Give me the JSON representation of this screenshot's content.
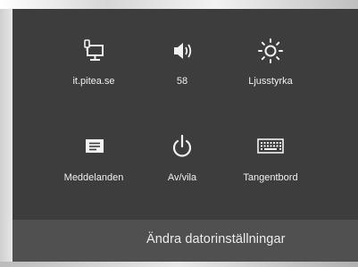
{
  "settings_pane": {
    "tiles": [
      {
        "label": "it.pitea.se",
        "icon": "network-monitor-icon"
      },
      {
        "label": "58",
        "icon": "speaker-volume-icon"
      },
      {
        "label": "Ljusstyrka",
        "icon": "sun-brightness-icon"
      },
      {
        "label": "Meddelanden",
        "icon": "notifications-icon"
      },
      {
        "label": "Av/vila",
        "icon": "power-icon"
      },
      {
        "label": "Tangentbord",
        "icon": "keyboard-icon"
      }
    ],
    "change_pc_settings_label": "Ändra datorinställningar"
  },
  "colors": {
    "panel": "#3d3d3d",
    "footer": "#505050",
    "text": "#f0f0f0"
  }
}
